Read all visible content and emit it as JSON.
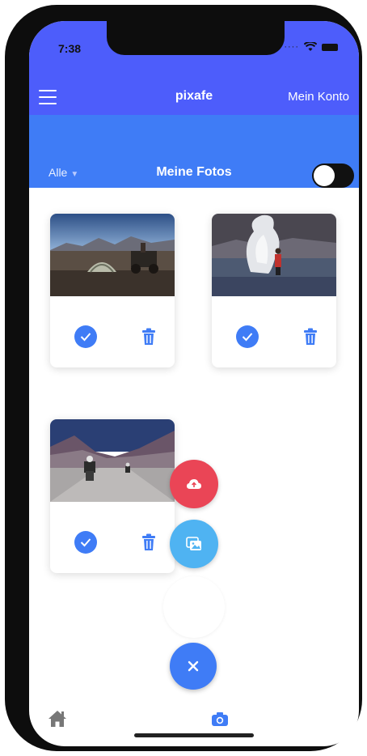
{
  "status_bar": {
    "time": "7:38",
    "signal_icon": "signal-dots-icon",
    "wifi_icon": "wifi-icon",
    "battery_icon": "battery-icon"
  },
  "navbar": {
    "menu_icon": "hamburger-menu-icon",
    "title": "pixafe",
    "account_label": "Mein Konto",
    "background_color": "#4d5dfb"
  },
  "subheader": {
    "filter_label": "Alle",
    "filter_icon": "caret-down-icon",
    "title": "Meine Fotos",
    "toggle_on": false,
    "background_color": "#3f7cf6"
  },
  "photos": [
    {
      "scene": "desert camp with tent and motorcycle",
      "select_icon": "check-circle-icon",
      "delete_icon": "trash-icon"
    },
    {
      "scene": "geyser steam with person",
      "select_icon": "check-circle-icon",
      "delete_icon": "trash-icon"
    },
    {
      "scene": "motorcycles on mountain road",
      "select_icon": "check-circle-icon",
      "delete_icon": "trash-icon"
    }
  ],
  "fab_menu": {
    "upload_icon": "cloud-upload-icon",
    "upload_color": "#ea4556",
    "gallery_icon": "image-gallery-icon",
    "gallery_color": "#4fb3f2",
    "close_icon": "close-icon",
    "close_color": "#3f7cf6"
  },
  "tabbar": {
    "home_icon": "home-icon",
    "camera_icon": "camera-icon",
    "active_tab": "camera"
  }
}
